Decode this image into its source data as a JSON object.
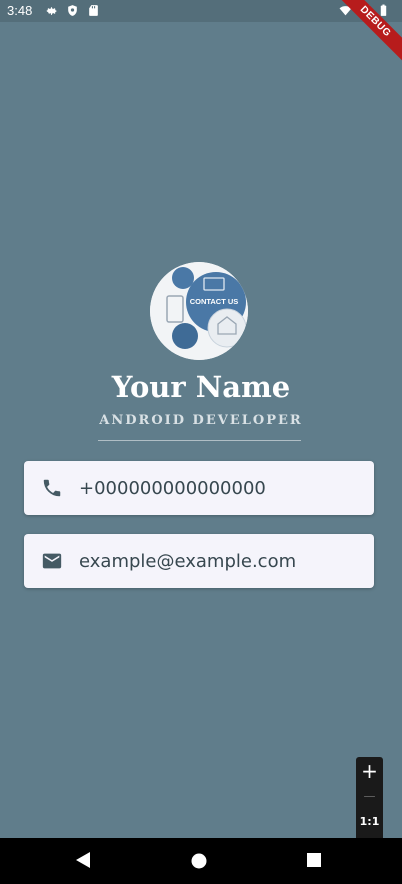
{
  "status_bar": {
    "time": "3:48",
    "left_icons": [
      "settings-icon",
      "shield-icon",
      "sd-card-icon"
    ],
    "right_icons": [
      "wifi-icon",
      "signal-icon",
      "battery-icon"
    ]
  },
  "debug_banner": {
    "label": "DEBUG"
  },
  "profile": {
    "avatar_text": "CONTACT US",
    "name": "Your Name",
    "title": "ANDROID DEVELOPER"
  },
  "contacts": {
    "phone": {
      "icon": "phone-icon",
      "value": "+000000000000000"
    },
    "email": {
      "icon": "mail-icon",
      "value": "example@example.com"
    }
  },
  "zoom_controls": {
    "zoom_in": "+",
    "zoom_out": "—",
    "reset": "1:1"
  },
  "nav_bar": {
    "buttons": [
      "back-icon",
      "home-icon",
      "recents-icon"
    ]
  },
  "colors": {
    "background": "#607d8b",
    "status_bar": "#546e7a",
    "card": "#f5f4fb",
    "icon": "#455a64"
  }
}
